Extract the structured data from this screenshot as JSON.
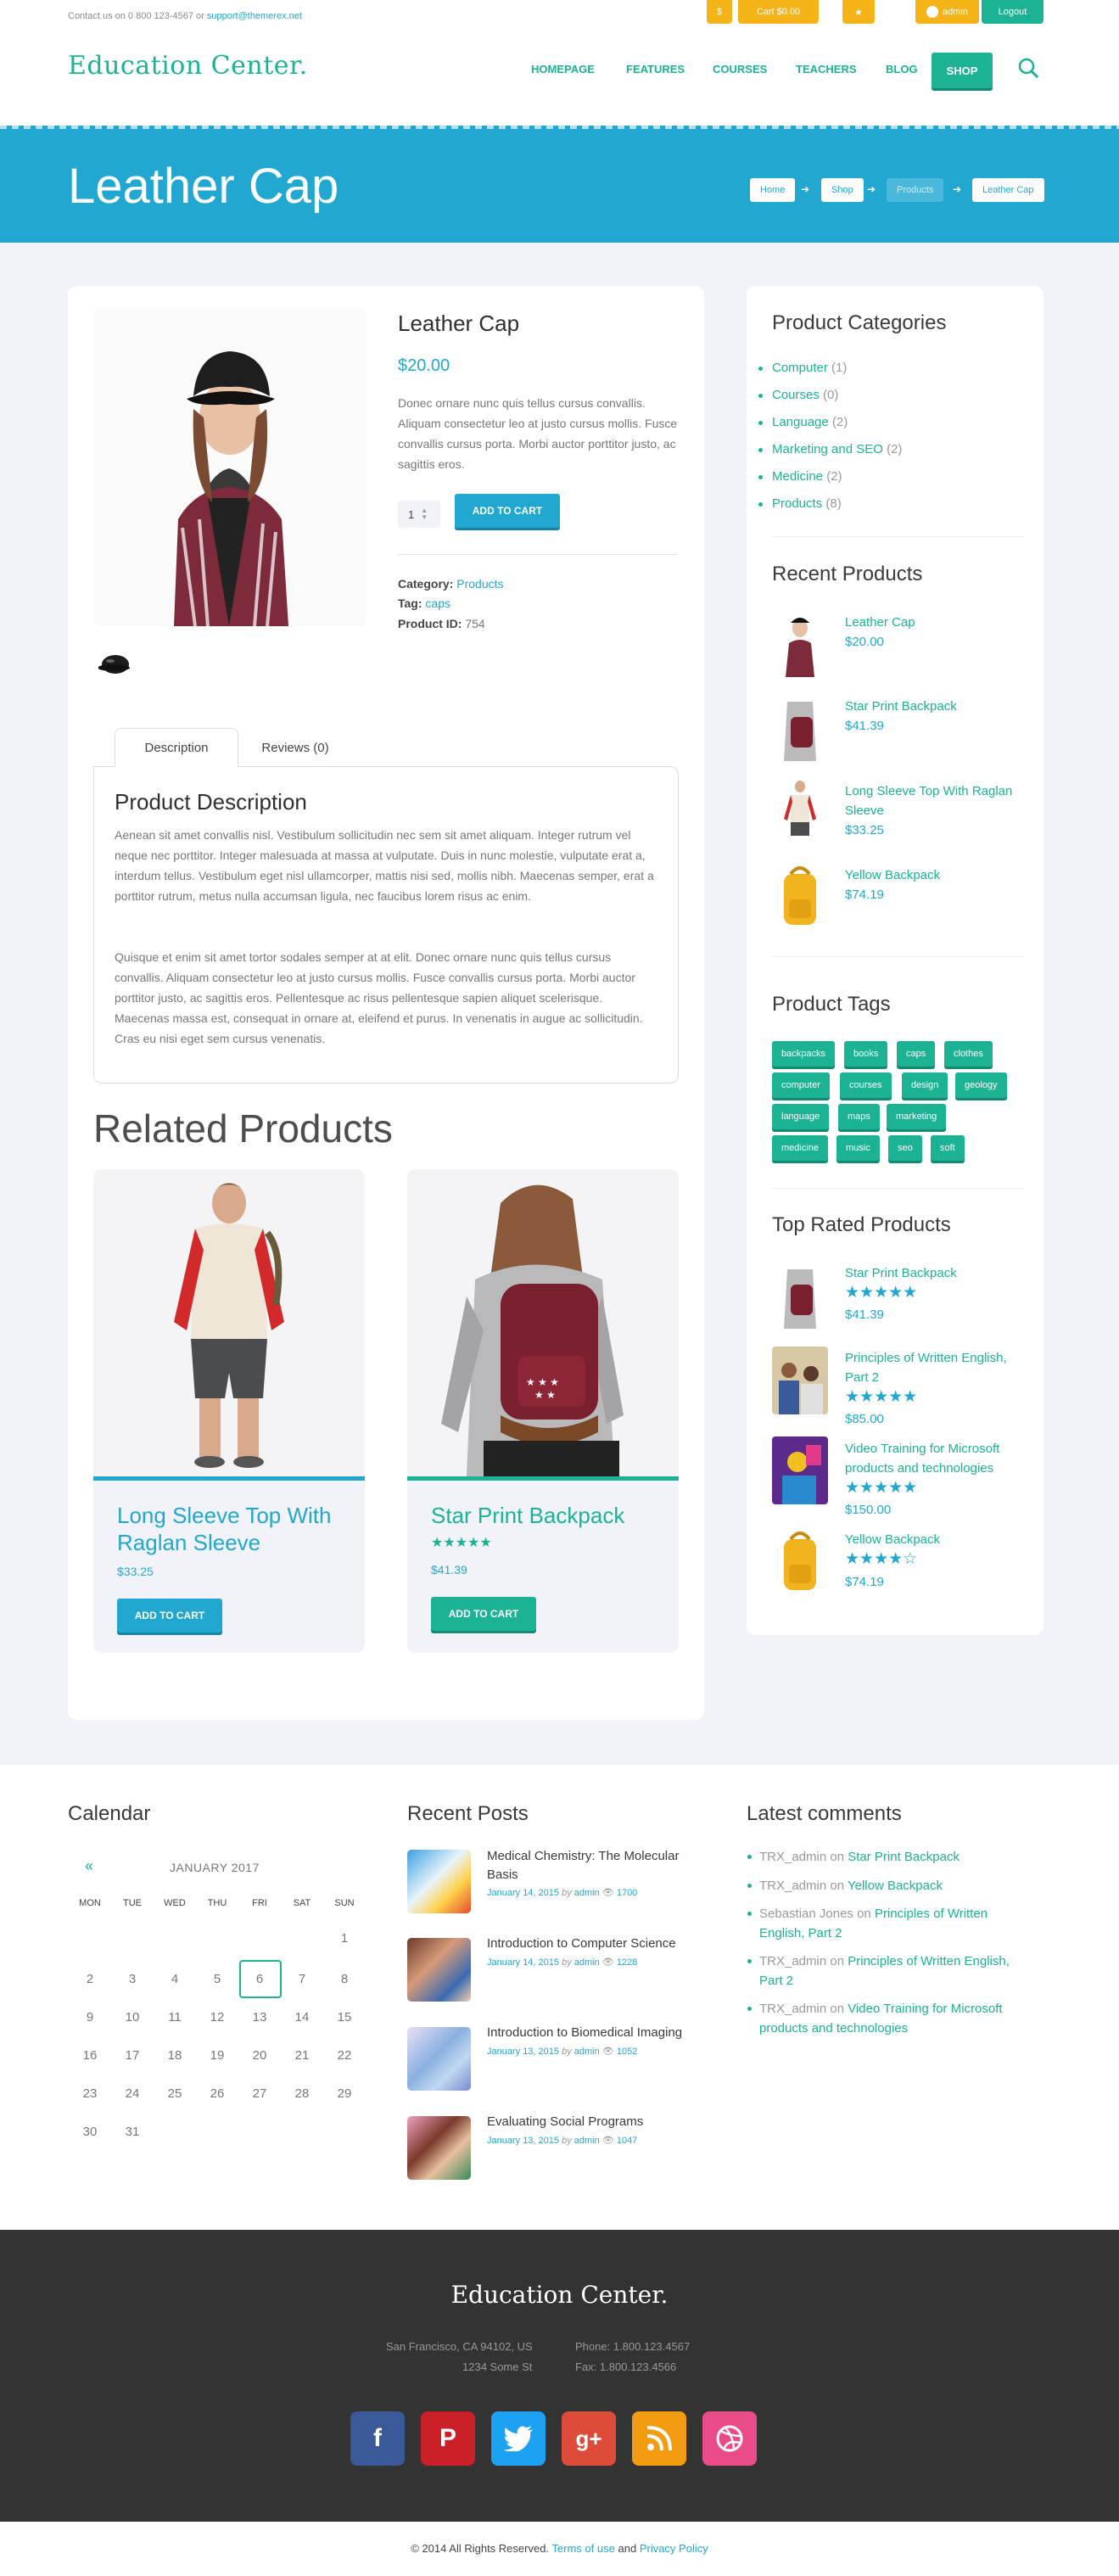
{
  "topbar": {
    "contact_prefix": "Contact us on 0 800 123-4567 or",
    "contact_email": "support@themerex.net",
    "currency": "$",
    "cart": "Cart $0.00",
    "bookmark_icon": "star-icon",
    "user": "admin",
    "logout": "Logout"
  },
  "header": {
    "logo": "Education Center.",
    "nav": [
      "HOMEPAGE",
      "FEATURES",
      "COURSES",
      "TEACHERS",
      "BLOG"
    ],
    "shop": "SHOP",
    "search_icon": "search-icon"
  },
  "hero": {
    "title": "Leather Cap",
    "breadcrumbs": [
      "Home",
      "Shop",
      "Products",
      "Leather Cap"
    ]
  },
  "product": {
    "title": "Leather Cap",
    "price": "$20.00",
    "description": "Donec ornare nunc quis tellus cursus convallis. Aliquam consectetur leo at justo cursus mollis. Fusce convallis cursus porta. Morbi auctor porttitor justo, ac sagittis eros.",
    "quantity": "1",
    "add_to_cart": "ADD TO CART",
    "category_label": "Category:",
    "category_value": "Products",
    "tag_label": "Tag:",
    "tag_value": "caps",
    "id_label": "Product ID:",
    "id_value": "754"
  },
  "tabs": {
    "description": "Description",
    "reviews": "Reviews (0)",
    "panel_title": "Product Description",
    "p1": "Aenean sit amet convallis nisl. Vestibulum sollicitudin nec sem sit amet aliquam. Integer rutrum vel neque nec porttitor. Integer malesuada at massa at vulputate. Duis in nunc molestie, vulputate erat a, interdum tellus. Vestibulum eget nisl ullamcorper, mattis nisi sed, mollis nibh. Maecenas semper, erat a porttitor rutrum, metus nulla accumsan ligula, nec faucibus lorem risus ac enim.",
    "p2": "Quisque et enim sit amet tortor sodales semper at at elit. Donec ornare nunc quis tellus cursus convallis. Aliquam consectetur leo at justo cursus mollis. Fusce convallis cursus porta. Morbi auctor porttitor justo, ac sagittis eros. Pellentesque ac risus pellentesque sapien aliquet scelerisque. Maecenas massa est, consequat in ornare at, eleifend et purus. In venenatis in augue ac sollicitudin. Cras eu nisi eget sem cursus venenatis."
  },
  "related": {
    "title": "Related Products",
    "items": [
      {
        "name": "Long Sleeve Top With Raglan Sleeve",
        "price": "$33.25",
        "button": "ADD TO CART",
        "color": "#22a7d0"
      },
      {
        "name": "Star Print Backpack",
        "price": "$41.39",
        "button": "ADD TO CART",
        "color": "#1bb393",
        "rating": 5
      }
    ]
  },
  "sidebar": {
    "categories_title": "Product Categories",
    "categories": [
      {
        "name": "Computer",
        "count": "(1)"
      },
      {
        "name": "Courses",
        "count": "(0)"
      },
      {
        "name": "Language",
        "count": "(2)"
      },
      {
        "name": "Marketing and SEO",
        "count": "(2)"
      },
      {
        "name": "Medicine",
        "count": "(2)"
      },
      {
        "name": "Products",
        "count": "(8)"
      }
    ],
    "recent_title": "Recent Products",
    "recent": [
      {
        "name": "Leather Cap",
        "price": "$20.00"
      },
      {
        "name": "Star Print Backpack",
        "price": "$41.39"
      },
      {
        "name": "Long Sleeve Top With Raglan Sleeve",
        "price": "$33.25"
      },
      {
        "name": "Yellow Backpack",
        "price": "$74.19"
      }
    ],
    "tags_title": "Product Tags",
    "tags": [
      "backpacks",
      "books",
      "caps",
      "clothes",
      "computer",
      "courses",
      "design",
      "geology",
      "language",
      "maps",
      "marketing",
      "medicine",
      "music",
      "seo",
      "soft"
    ],
    "top_title": "Top Rated Products",
    "top": [
      {
        "name": "Star Print Backpack",
        "price": "$41.39",
        "rating": 5
      },
      {
        "name": "Principles of Written English, Part 2",
        "price": "$85.00",
        "rating": 5
      },
      {
        "name": "Video Training for Microsoft products and technologies",
        "price": "$150.00",
        "rating": 5
      },
      {
        "name": "Yellow Backpack",
        "price": "$74.19",
        "rating": 4
      }
    ]
  },
  "calendar": {
    "title": "Calendar",
    "prev": "«",
    "month": "JANUARY 2017",
    "dow": [
      "MON",
      "TUE",
      "WED",
      "THU",
      "FRI",
      "SAT",
      "SUN"
    ],
    "today": "6",
    "weeks": [
      [
        "",
        "",
        "",
        "",
        "",
        "",
        "1"
      ],
      [
        "2",
        "3",
        "4",
        "5",
        "6",
        "7",
        "8"
      ],
      [
        "9",
        "10",
        "11",
        "12",
        "13",
        "14",
        "15"
      ],
      [
        "16",
        "17",
        "18",
        "19",
        "20",
        "21",
        "22"
      ],
      [
        "23",
        "24",
        "25",
        "26",
        "27",
        "28",
        "29"
      ],
      [
        "30",
        "31",
        "",
        "",
        "",
        "",
        ""
      ]
    ]
  },
  "recent_posts": {
    "title": "Recent Posts",
    "items": [
      {
        "title": "Medical Chemistry: The Molecular Basis",
        "date": "January 14, 2015",
        "by": "by",
        "author": "admin",
        "views": "1700"
      },
      {
        "title": "Introduction to Computer Science",
        "date": "January 14, 2015",
        "by": "by",
        "author": "admin",
        "views": "1228"
      },
      {
        "title": "Introduction to Biomedical Imaging",
        "date": "January 13, 2015",
        "by": "by",
        "author": "admin",
        "views": "1052"
      },
      {
        "title": "Evaluating Social Programs",
        "date": "January 13, 2015",
        "by": "by",
        "author": "admin",
        "views": "1047"
      }
    ]
  },
  "comments": {
    "title": "Latest comments",
    "on": "on",
    "items": [
      {
        "author": "TRX_admin",
        "post": "Star Print Backpack"
      },
      {
        "author": "TRX_admin",
        "post": "Yellow Backpack"
      },
      {
        "author": "Sebastian Jones",
        "post": "Principles of Written English, Part 2"
      },
      {
        "author": "TRX_admin",
        "post": "Principles of Written English, Part 2"
      },
      {
        "author": "TRX_admin",
        "post": "Video Training for Microsoft products and technologies"
      }
    ]
  },
  "footer": {
    "logo": "Education Center.",
    "address1": "San Francisco, CA 94102, US",
    "address2": "1234 Some St",
    "phone": "Phone: 1.800.123.4567",
    "fax": "Fax: 1.800.123.4566",
    "social": [
      "facebook-icon",
      "pinterest-icon",
      "twitter-icon",
      "google-plus-icon",
      "rss-icon",
      "dribbble-icon"
    ],
    "copyright_prefix": "© 2014 All Rights Reserved.",
    "terms": "Terms of use",
    "and": "and",
    "privacy": "Privacy Policy"
  }
}
